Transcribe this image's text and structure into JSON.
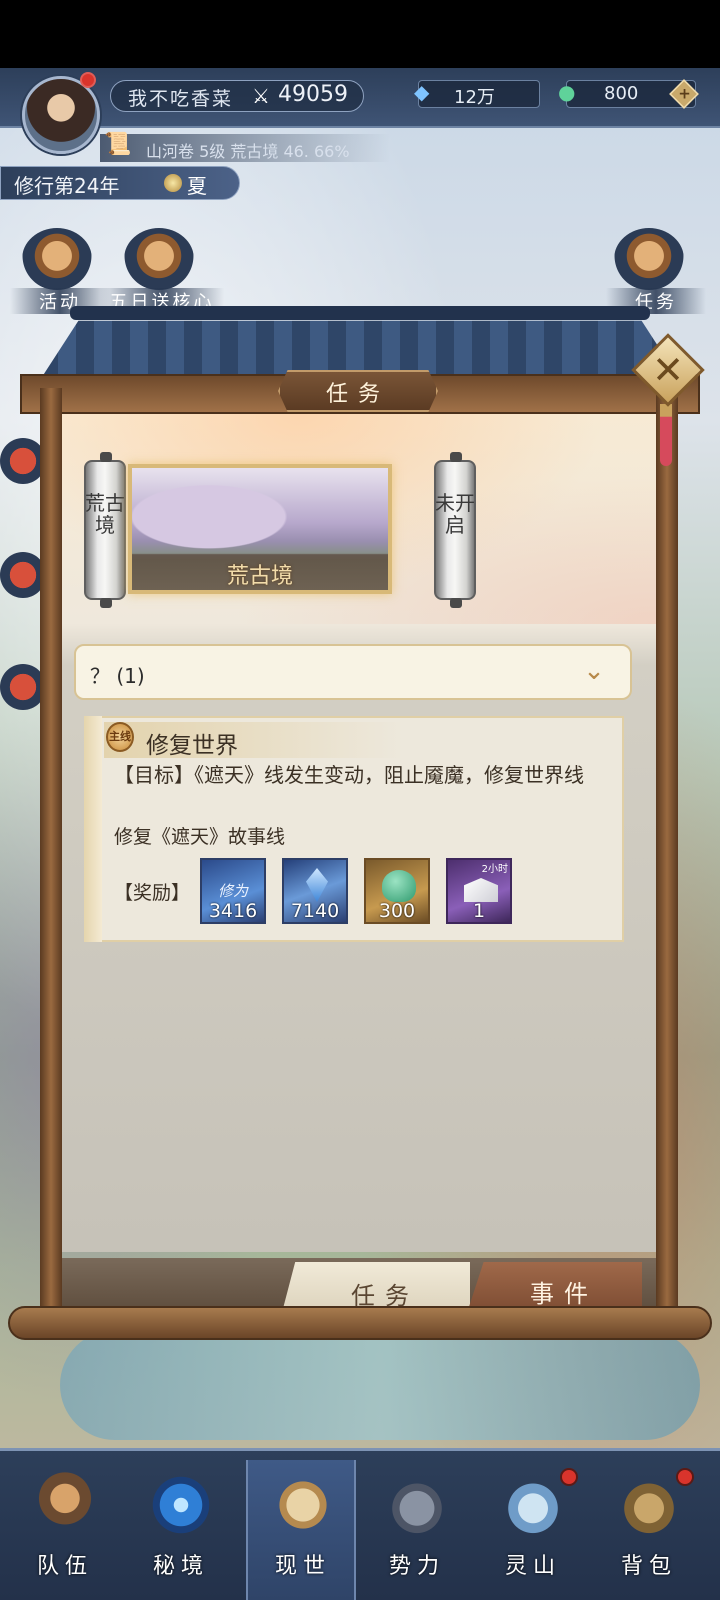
{
  "player": {
    "name": "我不吃香菜",
    "power": "49059",
    "gems": "12万",
    "jade": "800",
    "progress_text": "山河卷 5级 荒古境 46. 66%",
    "cultivation_year": "修行第24年",
    "season": "夏"
  },
  "top_menu": {
    "activity": "活动",
    "core_gift": "五日送核心",
    "tasks": "任务"
  },
  "modal": {
    "title": "任务",
    "realm_left_scroll": "荒古境",
    "realm_card": "荒古境",
    "realm_right_scroll": "未开启",
    "filter_label": "？ (1)"
  },
  "task": {
    "badge": "主线",
    "title": "修复世界",
    "goal": "【目标】《遮天》线发生变动，阻止魇魔，修复世界线",
    "description": "修复《遮天》故事线",
    "reward_label": "【奖励】",
    "rewards": [
      {
        "name": "修为",
        "count": "3416"
      },
      {
        "name": "crystal-icon",
        "count": "7140"
      },
      {
        "name": "jade-bag-icon",
        "count": "300"
      },
      {
        "name": "envelope-icon",
        "count": "1",
        "tag": "2小时"
      }
    ]
  },
  "modal_tabs": {
    "task": "任务",
    "event": "事件"
  },
  "bottom_nav": [
    {
      "label": "队伍",
      "badge": false
    },
    {
      "label": "秘境",
      "badge": false
    },
    {
      "label": "现世",
      "badge": false,
      "active": true
    },
    {
      "label": "势力",
      "badge": false
    },
    {
      "label": "灵山",
      "badge": true
    },
    {
      "label": "背包",
      "badge": true
    }
  ],
  "colors": {
    "navy": "#2d3f5a",
    "wood": "#6f4a2c",
    "gold": "#d8b978",
    "badge_red": "#d9342c"
  }
}
